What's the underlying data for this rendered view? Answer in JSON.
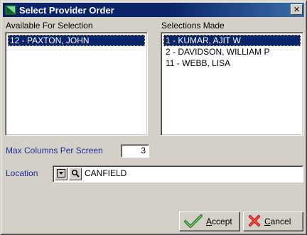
{
  "window": {
    "title": "Select Provider Order",
    "close_glyph": "✕"
  },
  "available": {
    "label": "Available For Selection",
    "items": [
      "12 - PAXTON, JOHN"
    ]
  },
  "selections": {
    "label": "Selections Made",
    "items": [
      "1 - KUMAR, AJIT W",
      "2 - DAVIDSON, WILLIAM P",
      "11 - WEBB, LISA"
    ]
  },
  "max_columns": {
    "label": "Max Columns Per Screen",
    "value": "3"
  },
  "location": {
    "label": "Location",
    "value": "CANFIELD",
    "dropdown_icon": "dropdown-icon",
    "search_icon": "search-icon"
  },
  "buttons": {
    "accept_label": "Accept",
    "accept_mnemonic": "A",
    "accept_rest": "ccept",
    "cancel_label": "Cancel",
    "cancel_mnemonic": "C",
    "cancel_rest": "ancel"
  },
  "colors": {
    "titlebar": "#0a246a",
    "selection": "#0a246a",
    "label_blue": "#1c2b9c"
  }
}
